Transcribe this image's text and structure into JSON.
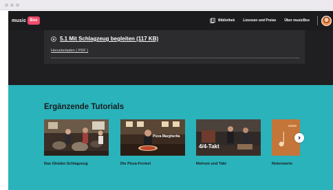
{
  "app": {
    "logo_word": "music",
    "logo_badge": "Box"
  },
  "nav": {
    "items": [
      {
        "label": "Bibliothek",
        "icon": "library-icon"
      },
      {
        "label": "Lizenzen und Preise"
      },
      {
        "label": "Über musicBox"
      }
    ],
    "avatar": "user-avatar"
  },
  "download": {
    "title": "5.1 Mit Schlagzeug begleiten (117 KB)",
    "link": "Herunterladen ( PDF )",
    "icon": "download-icon"
  },
  "tutorials": {
    "heading": "Ergänzende Tutorials",
    "items": [
      {
        "label": "Das Ghüder-Schlagzeug",
        "caption": ""
      },
      {
        "label": "Die Pizza-Formel",
        "caption": "Pizza Margherita"
      },
      {
        "label": "Metrum und Takt",
        "caption": "4/4-Takt"
      },
      {
        "label": "Notenwerte",
        "caption": ""
      }
    ],
    "next_icon": "chevron-right-icon"
  },
  "colors": {
    "nav_bg": "#1b1b1d",
    "brand": "#ee4b6b",
    "teal": "#2ab3bb"
  }
}
